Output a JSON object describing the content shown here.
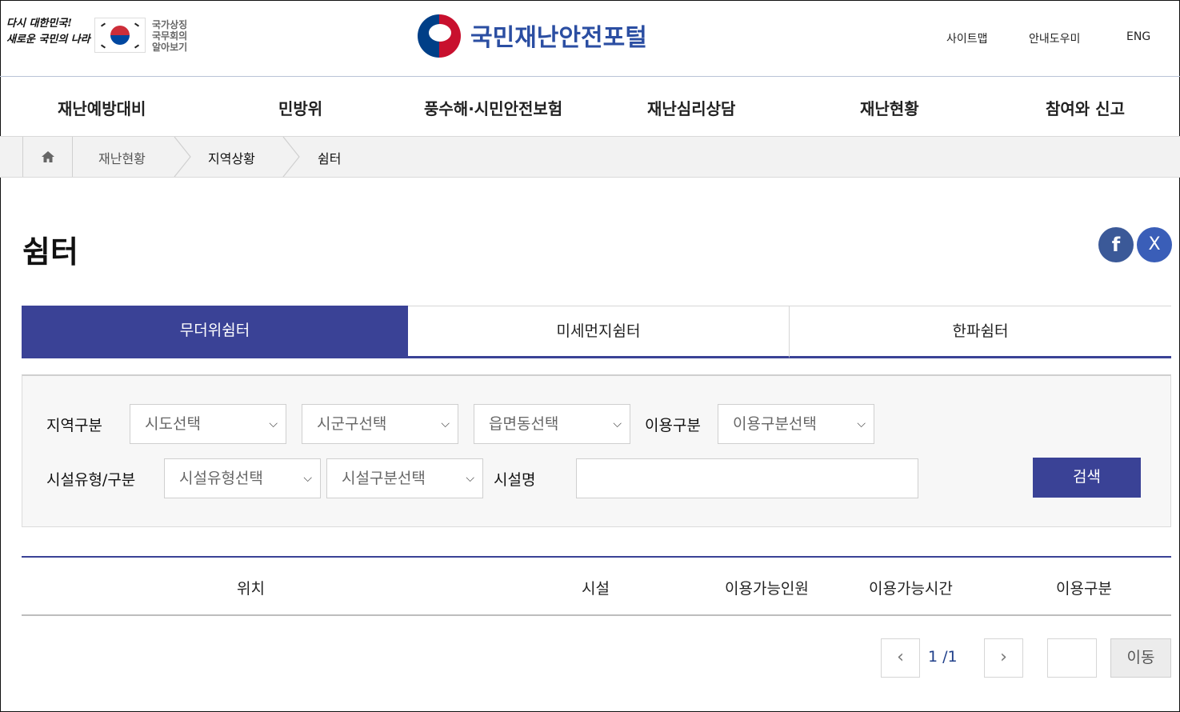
{
  "header": {
    "slogan": [
      "다시 대한민국!",
      "새로운 국민의 나라"
    ],
    "national_symbol_text": [
      "국가상징",
      "국무회의",
      "알아보기"
    ],
    "logo_text": "국민재난안전포털",
    "util_links": [
      "사이트맵",
      "안내도우미",
      "ENG"
    ]
  },
  "nav": {
    "items": [
      "재난예방대비",
      "민방위",
      "풍수해·시민안전보험",
      "재난심리상담",
      "재난현황",
      "참여와 신고"
    ]
  },
  "breadcrumb": {
    "items": [
      "재난현황",
      "지역상황",
      "쉼터"
    ]
  },
  "page": {
    "title": "쉼터",
    "sns": [
      "f",
      "X"
    ]
  },
  "tabs": {
    "items": [
      "무더위쉼터",
      "미세먼지쉼터",
      "한파쉼터"
    ],
    "active": "무더위쉼터"
  },
  "search": {
    "region_label": "지역구분",
    "sido": "시도선택",
    "sigungu": "시군구선택",
    "eupmyeondong": "읍면동선택",
    "use_label": "이용구분",
    "use_select": "이용구분선택",
    "facility_type_label": "시설유형/구분",
    "facility_type": "시설유형선택",
    "facility_class": "시설구분선택",
    "facility_name_label": "시설명",
    "facility_name_value": "",
    "button": "검색"
  },
  "table": {
    "columns": [
      "위치",
      "시설",
      "이용가능인원",
      "이용가능시간",
      "이용구분"
    ]
  },
  "pagination": {
    "current": "1 /1",
    "prev": "‹",
    "next": "›",
    "go_label": "이동",
    "page_input": ""
  },
  "colors": {
    "primary": "#3a4296",
    "logo_blue": "#2b4ea2",
    "sns_blue": "#3a5eb8"
  }
}
